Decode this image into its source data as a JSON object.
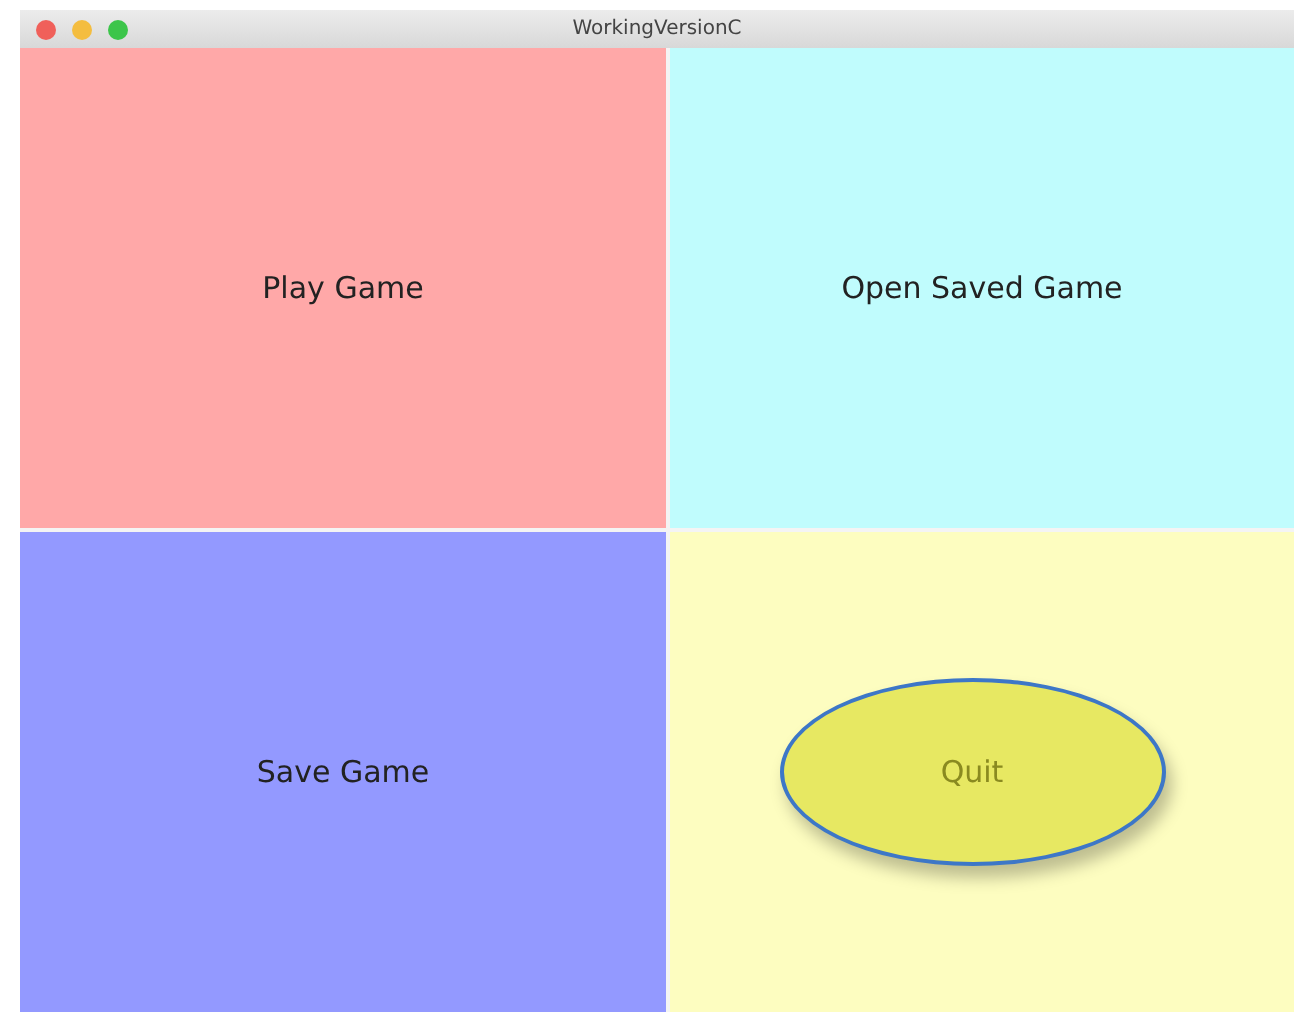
{
  "window": {
    "title": "WorkingVersionC"
  },
  "buttons": [
    {
      "label": "Play Game",
      "kind": "panel",
      "color": "#ffa8a8"
    },
    {
      "label": "Open Saved Game",
      "kind": "panel",
      "color": "#c0fcfd"
    },
    {
      "label": "Save Game",
      "kind": "panel",
      "color": "#9399ff"
    },
    {
      "label": "Quit",
      "kind": "ellipse",
      "color": "#e7e862"
    }
  ]
}
